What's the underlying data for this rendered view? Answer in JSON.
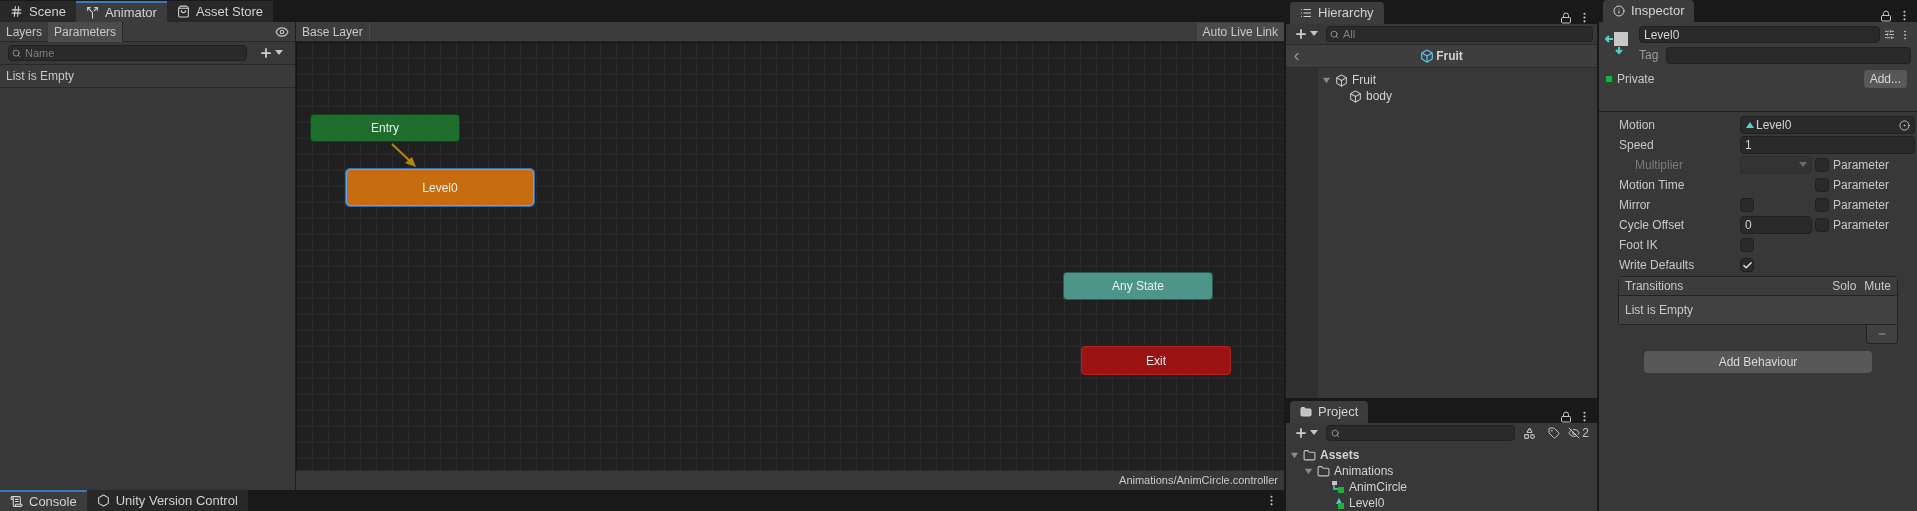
{
  "animator": {
    "tabs": [
      {
        "label": "Scene",
        "kind": "scene",
        "selected": false
      },
      {
        "label": "Animator",
        "kind": "animator",
        "selected": true
      },
      {
        "label": "Asset Store",
        "kind": "store",
        "selected": false
      }
    ],
    "side_tabs": [
      {
        "label": "Layers",
        "selected": false
      },
      {
        "label": "Parameters",
        "selected": true
      }
    ],
    "search": {
      "placeholder": "Name"
    },
    "empty_text": "List is Empty",
    "breadcrumb": "Base Layer",
    "live_link_button": "Auto Live Link",
    "states": [
      {
        "label": "Entry",
        "kind": "entry",
        "selected": false
      },
      {
        "label": "Level0",
        "kind": "default",
        "selected": true
      },
      {
        "label": "Any State",
        "kind": "any",
        "selected": false
      },
      {
        "label": "Exit",
        "kind": "exit",
        "selected": false
      }
    ],
    "path": "Animations/AnimCircle.controller"
  },
  "console_tabs": [
    {
      "label": "Console",
      "kind": "console",
      "selected": true
    },
    {
      "label": "Unity Version Control",
      "kind": "vcs",
      "selected": false
    }
  ],
  "hierarchy": {
    "title": "Hierarchy",
    "search": {
      "placeholder": "All"
    },
    "scene_title": "Fruit",
    "tree": [
      {
        "label": "Fruit",
        "expanded": true,
        "children": [
          {
            "label": "body"
          }
        ]
      }
    ]
  },
  "project": {
    "title": "Project",
    "hidden_count": "2",
    "tree": [
      {
        "label": "Assets",
        "kind": "root",
        "expanded": true,
        "children": [
          {
            "label": "Animations",
            "kind": "folder",
            "expanded": true,
            "children": [
              {
                "label": "AnimCircle",
                "kind": "controller"
              },
              {
                "label": "Level0",
                "kind": "clip"
              }
            ]
          }
        ]
      }
    ]
  },
  "inspector": {
    "title": "Inspector",
    "name_value": "Level0",
    "tag_label": "Tag",
    "private": {
      "label": "Private",
      "checked": true
    },
    "add_button": "Add...",
    "fields": [
      {
        "kind": "object",
        "label": "Motion",
        "value": "Level0"
      },
      {
        "kind": "text",
        "label": "Speed",
        "value": "1"
      },
      {
        "kind": "dropdown",
        "label": "Multiplier",
        "disabled": true,
        "parameter": {
          "label": "Parameter",
          "checked": false
        }
      },
      {
        "kind": "none",
        "label": "Motion Time",
        "parameter": {
          "label": "Parameter",
          "checked": false
        }
      },
      {
        "kind": "checkbox",
        "label": "Mirror",
        "checked": false,
        "parameter": {
          "label": "Parameter",
          "checked": false
        }
      },
      {
        "kind": "text",
        "label": "Cycle Offset",
        "value": "0",
        "parameter": {
          "label": "Parameter",
          "checked": false
        }
      },
      {
        "kind": "checkbox",
        "label": "Foot IK",
        "checked": false
      },
      {
        "kind": "checkbox",
        "label": "Write Defaults",
        "checked": true
      }
    ],
    "transitions": {
      "title": "Transitions",
      "columns": [
        "Solo",
        "Mute"
      ],
      "empty_text": "List is Empty"
    },
    "add_behaviour_button": "Add Behaviour"
  }
}
